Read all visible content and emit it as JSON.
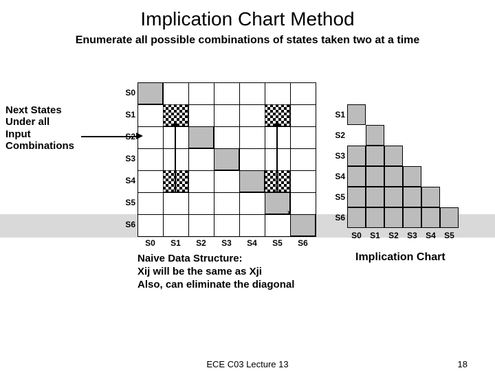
{
  "title": "Implication Chart Method",
  "subtitle": "Enumerate all possible combinations of states taken two at a time",
  "states": [
    "S0",
    "S1",
    "S2",
    "S3",
    "S4",
    "S5",
    "S6"
  ],
  "leftGrid": {
    "rows": [
      "S0",
      "S1",
      "S2",
      "S3",
      "S4",
      "S5",
      "S6"
    ],
    "cols": [
      "S0",
      "S1",
      "S2",
      "S3",
      "S4",
      "S5",
      "S6"
    ],
    "hatched": [
      [
        1,
        1
      ],
      [
        1,
        5
      ],
      [
        4,
        1
      ],
      [
        4,
        5
      ]
    ]
  },
  "rightChart": {
    "rowLabels": [
      "S1",
      "S2",
      "S3",
      "S4",
      "S5",
      "S6"
    ],
    "colLabels": [
      "S0",
      "S1",
      "S2",
      "S3",
      "S4",
      "S5"
    ],
    "title": "Implication Chart"
  },
  "annotation": {
    "l1": "Next States",
    "l2": "Under all",
    "l3": "Input",
    "l4": "Combinations"
  },
  "naive": {
    "l1": "Naive Data Structure:",
    "l2": "Xij will be the same as Xji",
    "l3": "Also, can eliminate the diagonal"
  },
  "footer": {
    "center": "ECE C03 Lecture 13",
    "page": "18"
  }
}
